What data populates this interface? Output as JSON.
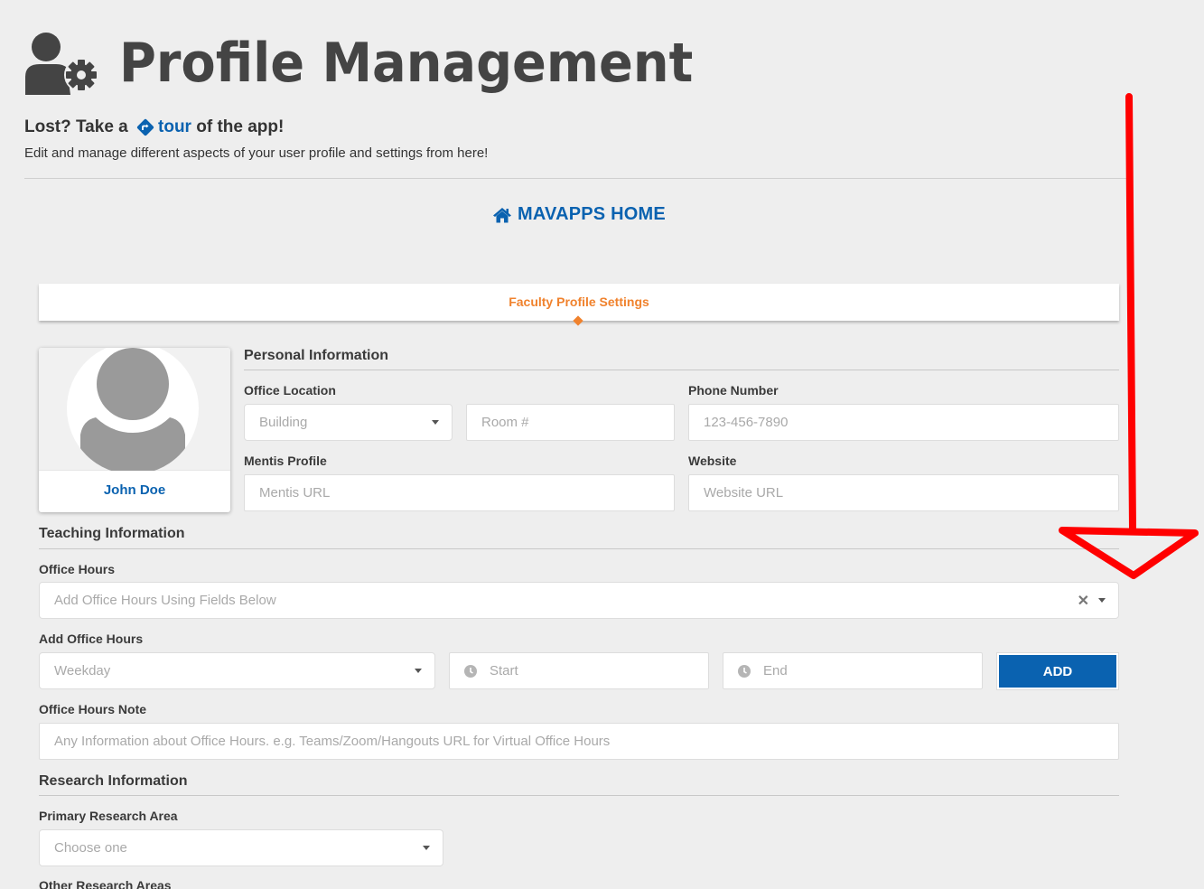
{
  "header": {
    "icon": "user-cog-icon",
    "title": "Profile Management"
  },
  "tour": {
    "prefix": "Lost? Take a ",
    "icon": "directions-diamond-icon",
    "link_label": "tour",
    "suffix": " of the app!"
  },
  "subtitle": "Edit and manage different aspects of your user profile and settings from here!",
  "home_link": {
    "icon": "home-icon",
    "label": "MAVAPPS HOME"
  },
  "tabs": [
    {
      "label": "Faculty Profile Settings",
      "active": true
    }
  ],
  "profile": {
    "avatar": "default-user-avatar",
    "name": "John Doe"
  },
  "personal": {
    "title": "Personal Information",
    "office_location_label": "Office Location",
    "building_placeholder": "Building",
    "room_placeholder": "Room #",
    "phone_label": "Phone Number",
    "phone_placeholder": "123-456-7890",
    "mentis_label": "Mentis Profile",
    "mentis_placeholder": "Mentis URL",
    "website_label": "Website",
    "website_placeholder": "Website URL"
  },
  "teaching": {
    "title": "Teaching Information",
    "office_hours_label": "Office Hours",
    "office_hours_placeholder": "Add Office Hours Using Fields Below",
    "add_office_hours_label": "Add Office Hours",
    "weekday_placeholder": "Weekday",
    "start_placeholder": "Start",
    "end_placeholder": "End",
    "add_button": "ADD",
    "note_label": "Office Hours Note",
    "note_placeholder": "Any Information about Office Hours. e.g. Teams/Zoom/Hangouts URL for Virtual Office Hours"
  },
  "research": {
    "title": "Research Information",
    "primary_label": "Primary Research Area",
    "primary_placeholder": "Choose one",
    "other_label": "Other Research Areas"
  },
  "annotation": {
    "type": "red-arrow-down",
    "color": "#ff0000"
  },
  "colors": {
    "accent_blue": "#0a62b0",
    "accent_orange": "#f0822d",
    "background": "#eeeeee"
  }
}
